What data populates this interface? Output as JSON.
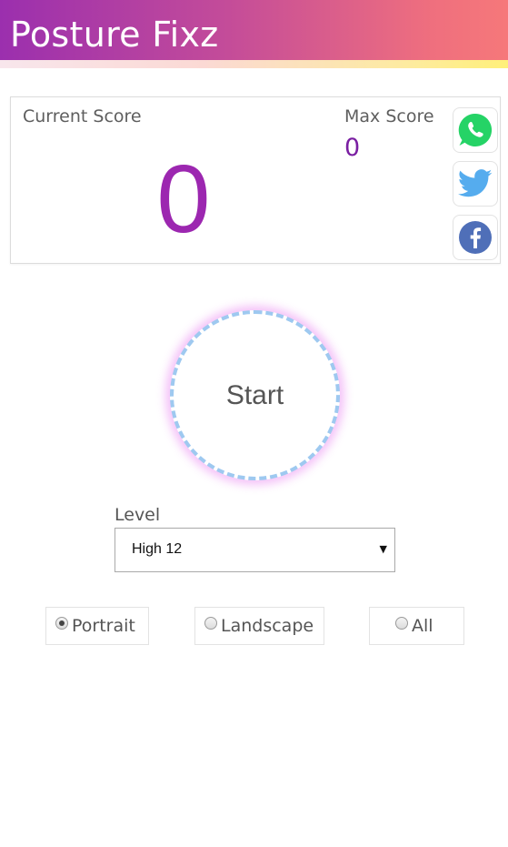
{
  "app": {
    "title": "Posture Fixz"
  },
  "scores": {
    "current_label": "Current Score",
    "current_value": "0",
    "max_label": "Max Score",
    "max_value": "0"
  },
  "share": {
    "icons": [
      "whatsapp-icon",
      "twitter-icon",
      "facebook-icon"
    ]
  },
  "start": {
    "label": "Start"
  },
  "level": {
    "label": "Level",
    "selected": "High 12"
  },
  "orientation": {
    "options": [
      {
        "label": "Portrait",
        "checked": true
      },
      {
        "label": "Landscape",
        "checked": false
      },
      {
        "label": "All",
        "checked": false
      }
    ]
  },
  "colors": {
    "header_gradient_start": "#9b2fae",
    "header_gradient_end": "#f6787a",
    "score_purple": "#9c27b0",
    "start_dash": "#9ec9f0",
    "start_glow": "#e778f0",
    "whatsapp": "#25d366",
    "twitter": "#55acee",
    "facebook": "#4f6fb8"
  }
}
